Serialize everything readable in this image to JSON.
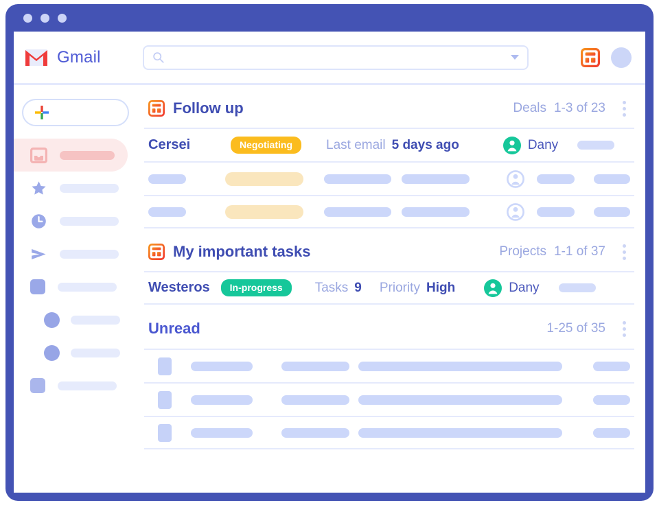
{
  "window": {
    "dots": [
      "close-dot",
      "minimize-dot",
      "maximize-dot"
    ],
    "frame_color": "#4453b4"
  },
  "header": {
    "brand": "Gmail",
    "logo_icon": "gmail-m-icon",
    "search": {
      "placeholder": "",
      "value": "",
      "icon": "search-icon",
      "dropdown_icon": "caret-down-icon"
    },
    "board_icon": "board-grid-icon",
    "avatar": "user-avatar"
  },
  "sidebar": {
    "compose": {
      "icon": "colored-plus-icon",
      "label": ""
    },
    "items": [
      {
        "icon": "inbox-icon",
        "label": "",
        "active": true
      },
      {
        "icon": "star-icon",
        "label": "",
        "active": false
      },
      {
        "icon": "clock-icon",
        "label": "",
        "active": false
      },
      {
        "icon": "send-icon",
        "label": "",
        "active": false
      },
      {
        "icon": "square-icon",
        "label": "",
        "active": false
      },
      {
        "icon": "circle-icon",
        "label": "",
        "active": false,
        "indent": true
      },
      {
        "icon": "circle-icon",
        "label": "",
        "active": false,
        "indent": true
      },
      {
        "icon": "square-icon",
        "label": "",
        "active": false
      }
    ]
  },
  "sections": [
    {
      "id": "follow-up",
      "icon": "board-grid-icon",
      "title": "Follow up",
      "meta_label": "Deals",
      "meta_count": "1-3 of 23",
      "menu_icon": "kebab-menu-icon",
      "rows": [
        {
          "name": "Cersei",
          "badge": "Negotiating",
          "badge_color": "#fbbc1e",
          "field_label": "Last email",
          "field_value": "5 days ago",
          "assignee": "Dany",
          "assignee_icon": "person-avatar-teal"
        }
      ],
      "skeleton_rows": 2
    },
    {
      "id": "my-important-tasks",
      "icon": "board-grid-icon",
      "title": "My important tasks",
      "meta_label": "Projects",
      "meta_count": "1-1 of 37",
      "menu_icon": "kebab-menu-icon",
      "rows": [
        {
          "name": "Westeros",
          "badge": "In-progress",
          "badge_color": "#16c79a",
          "field_label": "Tasks",
          "field_value": "9",
          "field2_label": "Priority",
          "field2_value": "High",
          "assignee": "Dany",
          "assignee_icon": "person-avatar-teal"
        }
      ],
      "skeleton_rows": 0
    },
    {
      "id": "unread",
      "icon": "",
      "title": "Unread",
      "meta_label": "",
      "meta_count": "1-25 of 35",
      "menu_icon": "kebab-menu-icon",
      "rows": [],
      "skeleton_rows": 3
    }
  ],
  "colors": {
    "frame_indigo": "#4453b4",
    "accent_orange": "#f4622a",
    "text_indigo": "#3f4db2",
    "muted_blue": "#9aa7e0",
    "badge_amber": "#fbbc1e",
    "badge_teal": "#16c79a",
    "skeleton_blue": "#ccd7fa",
    "active_pink": "#fceaea"
  }
}
